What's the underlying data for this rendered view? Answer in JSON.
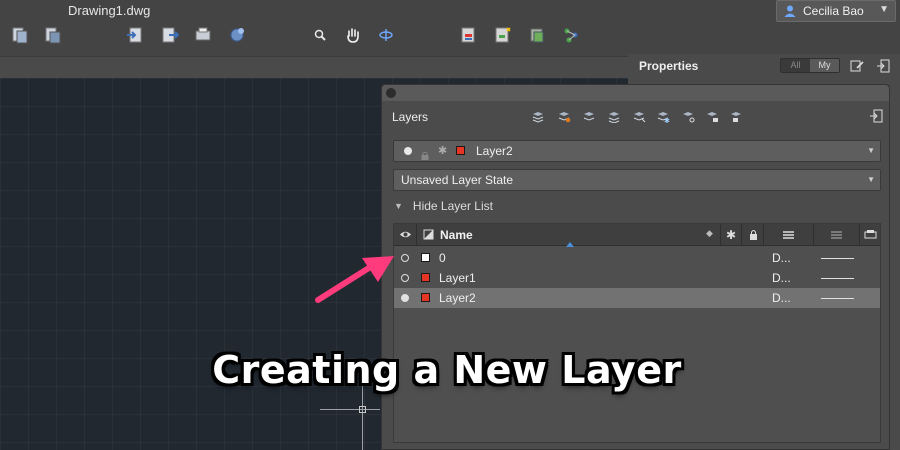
{
  "window": {
    "title": "Drawing1.dwg"
  },
  "user": {
    "name": "Cecilia Bao"
  },
  "toolbar": {
    "icons": [
      "new-icon",
      "save-icon",
      "import-icon",
      "export-icon",
      "plot-icon",
      "share-icon",
      "zoom-icon",
      "pan-icon",
      "orbit-icon",
      "layer-properties-icon",
      "layer-new-icon",
      "layer-manage-icon",
      "layer-states-icon"
    ]
  },
  "properties": {
    "title": "Properties",
    "seg_all": "All",
    "seg_my": "My"
  },
  "layers": {
    "title": "Layers",
    "current_layer": "Layer2",
    "layer_state": "Unsaved Layer State",
    "hide_list_label": "Hide Layer List",
    "columns": {
      "name": "Name"
    },
    "rows": [
      {
        "name": "0",
        "color": "#ffffff",
        "linetype": "D...",
        "visible": false,
        "selected": false
      },
      {
        "name": "Layer1",
        "color": "#e53524",
        "linetype": "D...",
        "visible": false,
        "selected": false
      },
      {
        "name": "Layer2",
        "color": "#e53524",
        "linetype": "D...",
        "visible": true,
        "selected": true
      }
    ]
  },
  "colors": {
    "accent": "#e53524",
    "canvas": "#212830",
    "arrow": "#ff3a7d",
    "sort_indicator": "#4a90d9"
  },
  "caption": "Creating a New Layer"
}
